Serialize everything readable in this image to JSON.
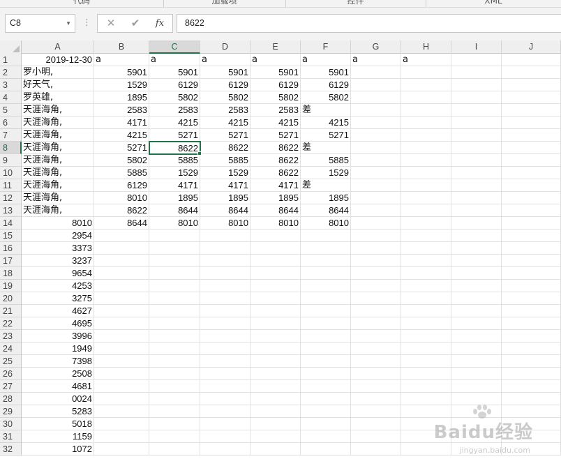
{
  "ribbon": {
    "groups": [
      "代码",
      "加载项",
      "控件",
      "XML"
    ]
  },
  "formula_bar": {
    "name_box": "C8",
    "more_icon": "vertical-dots",
    "cancel_icon": "✕",
    "enter_icon": "✔",
    "fx_label": "fx",
    "value": "8622"
  },
  "sheet": {
    "columns": [
      "A",
      "B",
      "C",
      "D",
      "E",
      "F",
      "G",
      "H",
      "I",
      "J"
    ],
    "active_column": "C",
    "active_row": 8,
    "selected_cell": "C8",
    "rows": [
      {
        "n": "1",
        "A": "2019-12-30",
        "B": "a",
        "C": "a",
        "D": "a",
        "E": "a",
        "F": "a",
        "G": "a",
        "H": "a"
      },
      {
        "n": "2",
        "A": "罗小明,",
        "B": "5901",
        "C": "5901",
        "D": "5901",
        "E": "5901",
        "F": "5901"
      },
      {
        "n": "3",
        "A": "好天气,",
        "B": "1529",
        "C": "6129",
        "D": "6129",
        "E": "6129",
        "F": "6129"
      },
      {
        "n": "4",
        "A": "罗英雄,",
        "B": "1895",
        "C": "5802",
        "D": "5802",
        "E": "5802",
        "F": "5802"
      },
      {
        "n": "5",
        "A": "天涯海角,",
        "B": "2583",
        "C": "2583",
        "D": "2583",
        "E": "2583",
        "F": "差"
      },
      {
        "n": "6",
        "A": "天涯海角,",
        "B": "4171",
        "C": "4215",
        "D": "4215",
        "E": "4215",
        "F": "4215"
      },
      {
        "n": "7",
        "A": "天涯海角,",
        "B": "4215",
        "C": "5271",
        "D": "5271",
        "E": "5271",
        "F": "5271"
      },
      {
        "n": "8",
        "A": "天涯海角,",
        "B": "5271",
        "C": "8622",
        "D": "8622",
        "E": "8622",
        "F": "差"
      },
      {
        "n": "9",
        "A": "天涯海角,",
        "B": "5802",
        "C": "5885",
        "D": "5885",
        "E": "8622",
        "F": "5885"
      },
      {
        "n": "10",
        "A": "天涯海角,",
        "B": "5885",
        "C": "1529",
        "D": "1529",
        "E": "8622",
        "F": "1529"
      },
      {
        "n": "11",
        "A": "天涯海角,",
        "B": "6129",
        "C": "4171",
        "D": "4171",
        "E": "4171",
        "F": "差"
      },
      {
        "n": "12",
        "A": "天涯海角,",
        "B": "8010",
        "C": "1895",
        "D": "1895",
        "E": "1895",
        "F": "1895"
      },
      {
        "n": "13",
        "A": "天涯海角,",
        "B": "8622",
        "C": "8644",
        "D": "8644",
        "E": "8644",
        "F": "8644"
      },
      {
        "n": "14",
        "A": "8010",
        "B": "8644",
        "C": "8010",
        "D": "8010",
        "E": "8010",
        "F": "8010"
      },
      {
        "n": "15",
        "A": "2954"
      },
      {
        "n": "16",
        "A": "3373"
      },
      {
        "n": "17",
        "A": "3237"
      },
      {
        "n": "18",
        "A": "9654"
      },
      {
        "n": "19",
        "A": "4253"
      },
      {
        "n": "20",
        "A": "3275"
      },
      {
        "n": "21",
        "A": "4627"
      },
      {
        "n": "22",
        "A": "4695"
      },
      {
        "n": "23",
        "A": "3996"
      },
      {
        "n": "24",
        "A": "1949"
      },
      {
        "n": "25",
        "A": "7398"
      },
      {
        "n": "26",
        "A": "2508"
      },
      {
        "n": "27",
        "A": "4681"
      },
      {
        "n": "28",
        "A": "0024"
      },
      {
        "n": "29",
        "A": "5283"
      },
      {
        "n": "30",
        "A": "5018"
      },
      {
        "n": "31",
        "A": "1159"
      },
      {
        "n": "32",
        "A": "1072"
      }
    ]
  },
  "watermark": {
    "text": "Baidu经验",
    "sub": "jingyan.baidu.com"
  },
  "colors": {
    "accent": "#217346",
    "header_bg": "#efefef",
    "gridline": "#e1e1e1"
  }
}
